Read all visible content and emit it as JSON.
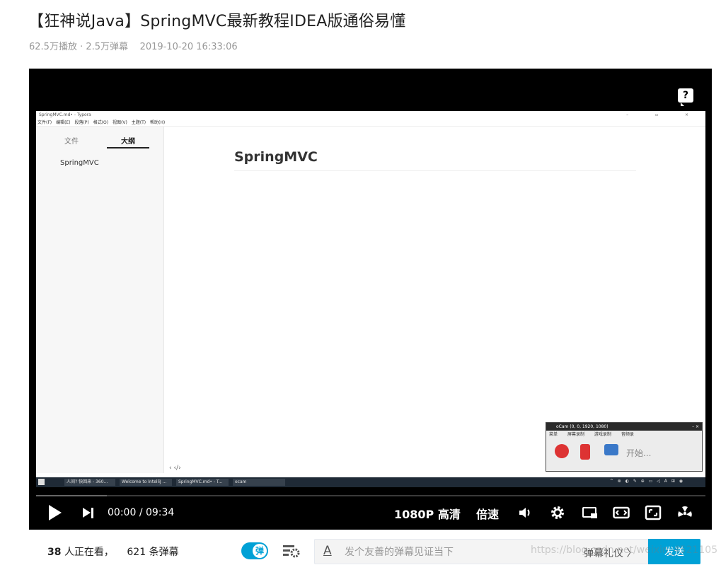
{
  "video": {
    "title": "【狂神说Java】SpringMVC最新教程IDEA版通俗易懂",
    "plays": "62.5万播放",
    "separator": "·",
    "danmaku": "2.5万弹幕",
    "date": "2019-10-20 16:33:06"
  },
  "screen": {
    "window_title": "SpringMVC.md• - Typora",
    "window_controls": "–  ▫  ×",
    "menu": [
      "文件(F)",
      "编辑(E)",
      "段落(P)",
      "格式(O)",
      "视图(V)",
      "主题(T)",
      "帮助(H)"
    ],
    "tabs": [
      "文件",
      "大纲"
    ],
    "outline_item": "SpringMVC",
    "footer": "‹  ‹/›",
    "heading": "SpringMVC",
    "taskbar_items": [
      "人间? 快回来 - 360...",
      "Welcome to IntelliJ ...",
      "SpringMVC.md• - T...",
      "ocam"
    ],
    "tray": "^ ⊗ ◐ ✎ ⊕ ▭ ◁ A ⊞ ◉"
  },
  "ocam": {
    "title": "oCam (0, 0, 1920, 1080)",
    "close": "– ×",
    "tabs": [
      "菜单",
      "屏幕录制",
      "游戏录制",
      "音频录"
    ],
    "start": "开始..."
  },
  "player": {
    "current_time": "00:00",
    "time_separator": "/",
    "duration": "09:34",
    "quality": "1080P 高清",
    "speed": "倍速",
    "help_glyph": "?"
  },
  "bottom": {
    "viewers_count": "38",
    "viewers_label": "人正在看，",
    "danmaku_count": "621",
    "danmaku_label": "条弹幕",
    "toggle_label": "弹",
    "input_placeholder": "发个友善的弹幕见证当下",
    "etiquette": "弹幕礼仪 〉",
    "send": "发送",
    "a_glyph": "A"
  },
  "watermark": "https://blog.csdn.net/weixin_4521105",
  "colors": {
    "accent": "#00a1d6",
    "player_bg": "#000000",
    "meta_text": "#999999"
  }
}
